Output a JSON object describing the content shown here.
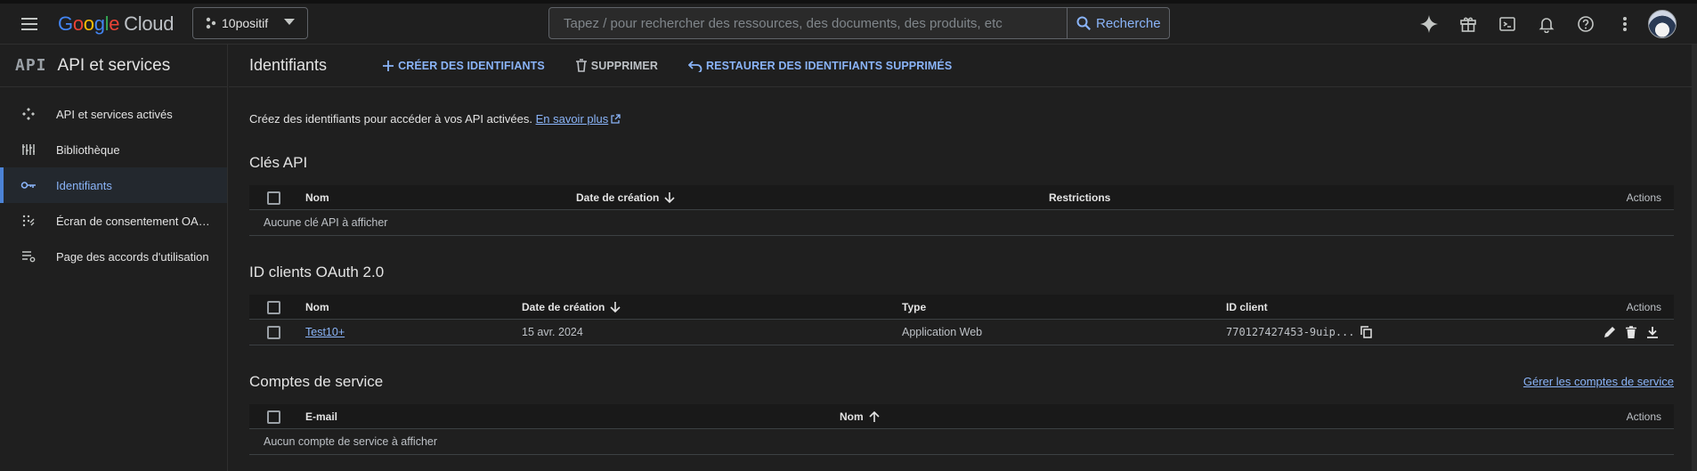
{
  "topbar": {
    "logo_letters": [
      {
        "char": "G",
        "color": "#4285f4"
      },
      {
        "char": "o",
        "color": "#ea4335"
      },
      {
        "char": "o",
        "color": "#fbbc05"
      },
      {
        "char": "g",
        "color": "#4285f4"
      },
      {
        "char": "l",
        "color": "#34a853"
      },
      {
        "char": "e",
        "color": "#ea4335"
      }
    ],
    "logo_cloud": "Cloud",
    "project_name": "10positif",
    "search_placeholder": "Tapez / pour rechercher des ressources, des documents, des produits, etc",
    "search_button": "Recherche",
    "icons": [
      "gemini-sparkle-icon",
      "gift-icon",
      "cloud-shell-icon",
      "notifications-icon",
      "help-icon",
      "more-vert-icon"
    ]
  },
  "sidebar": {
    "api_badge": "API",
    "title": "API et services",
    "items": [
      {
        "label": "API et services activés",
        "icon": "enabled-apis-icon",
        "active": false
      },
      {
        "label": "Bibliothèque",
        "icon": "library-icon",
        "active": false
      },
      {
        "label": "Identifiants",
        "icon": "key-icon",
        "active": true
      },
      {
        "label": "Écran de consentement OAuth",
        "icon": "consent-screen-icon",
        "active": false
      },
      {
        "label": "Page des accords d'utilisation",
        "icon": "agreements-icon",
        "active": false
      }
    ]
  },
  "main": {
    "title": "Identifiants",
    "toolbar": {
      "create": "CRÉER DES IDENTIFIANTS",
      "delete": "SUPPRIMER",
      "restore": "RESTAURER DES IDENTIFIANTS SUPPRIMÉS"
    },
    "intro_text": "Créez des identifiants pour accéder à vos API activées.",
    "intro_link": "En savoir plus",
    "api_keys": {
      "title": "Clés API",
      "columns": {
        "name": "Nom",
        "created": "Date de création",
        "restrictions": "Restrictions",
        "actions": "Actions"
      },
      "empty": "Aucune clé API à afficher"
    },
    "oauth": {
      "title": "ID clients OAuth 2.0",
      "columns": {
        "name": "Nom",
        "created": "Date de création",
        "type": "Type",
        "client_id": "ID client",
        "actions": "Actions"
      },
      "rows": [
        {
          "name": "Test10+",
          "created": "15 avr. 2024",
          "type": "Application Web",
          "client_id": "770127427453-9uip..."
        }
      ]
    },
    "service_accounts": {
      "title": "Comptes de service",
      "manage_link": "Gérer les comptes de service",
      "columns": {
        "email": "E-mail",
        "name": "Nom",
        "actions": "Actions"
      },
      "empty": "Aucun compte de service à afficher"
    }
  },
  "colors": {
    "background": "#1f1f1f",
    "accent": "#8ab4f8",
    "active_indicator": "#4c83d6",
    "text": "#e3e3e3"
  }
}
